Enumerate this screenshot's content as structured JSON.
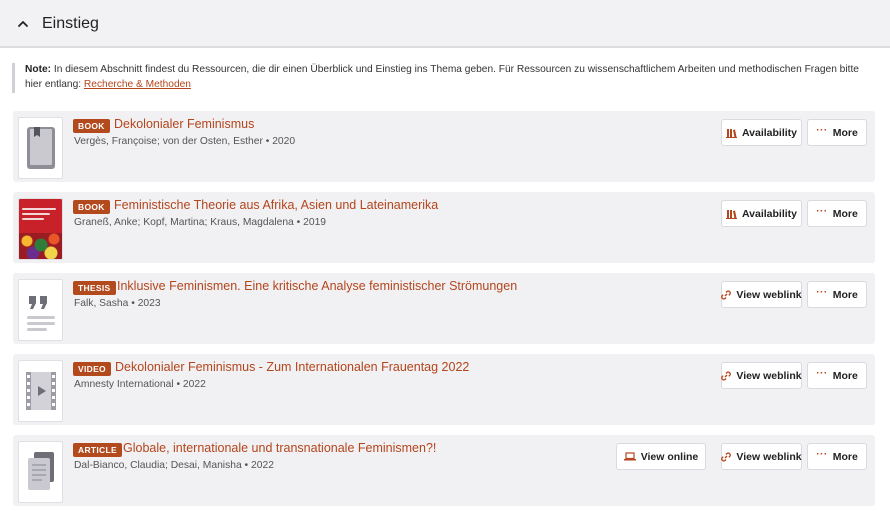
{
  "section": {
    "title": "Einstieg",
    "toggle_icon": "chevron-up-icon"
  },
  "note": {
    "label": "Note:",
    "text": "In diesem Abschnitt findest du Ressourcen, die dir einen Überblick und Einstieg ins Thema geben. Für Ressourcen zu wissenschaftlichem Arbeiten und methodischen Fragen bitte hier entlang:",
    "link": "Recherche & Methoden"
  },
  "colors": {
    "accent": "#b4451c",
    "badge": "#b34a1e",
    "card_bg": "#f1f1f3"
  },
  "items": [
    {
      "type": "BOOK",
      "title": "Dekolonialer Feminismus",
      "meta": "Vergès, Françoise; von der Osten, Esther • 2020",
      "thumb_icon": "book-icon",
      "actions": [
        "Availability",
        "More"
      ]
    },
    {
      "type": "BOOK",
      "title": "Feministische Theorie aus Afrika, Asien und Lateinamerika",
      "meta": "Graneß, Anke; Kopf, Martina; Kraus, Magdalena • 2019",
      "thumb_icon": "book-cover-image",
      "actions": [
        "Availability",
        "More"
      ]
    },
    {
      "type": "THESIS",
      "title": "Inklusive Feminismen. Eine kritische Analyse feministischer Strömungen",
      "meta": "Falk, Sasha • 2023",
      "thumb_icon": "quote-icon",
      "actions": [
        "View weblink",
        "More"
      ]
    },
    {
      "type": "VIDEO",
      "title": "Dekolonialer Feminismus - Zum Internationalen Frauentag 2022",
      "meta": "Amnesty International • 2022",
      "thumb_icon": "video-icon",
      "actions": [
        "View weblink",
        "More"
      ]
    },
    {
      "type": "ARTICLE",
      "title": "Globale, internationale und transnationale Feminismen?!",
      "meta": "Dal-Bianco, Claudia; Desai, Manisha • 2022",
      "thumb_icon": "article-icon",
      "actions": [
        "View online",
        "View weblink",
        "More"
      ]
    }
  ]
}
